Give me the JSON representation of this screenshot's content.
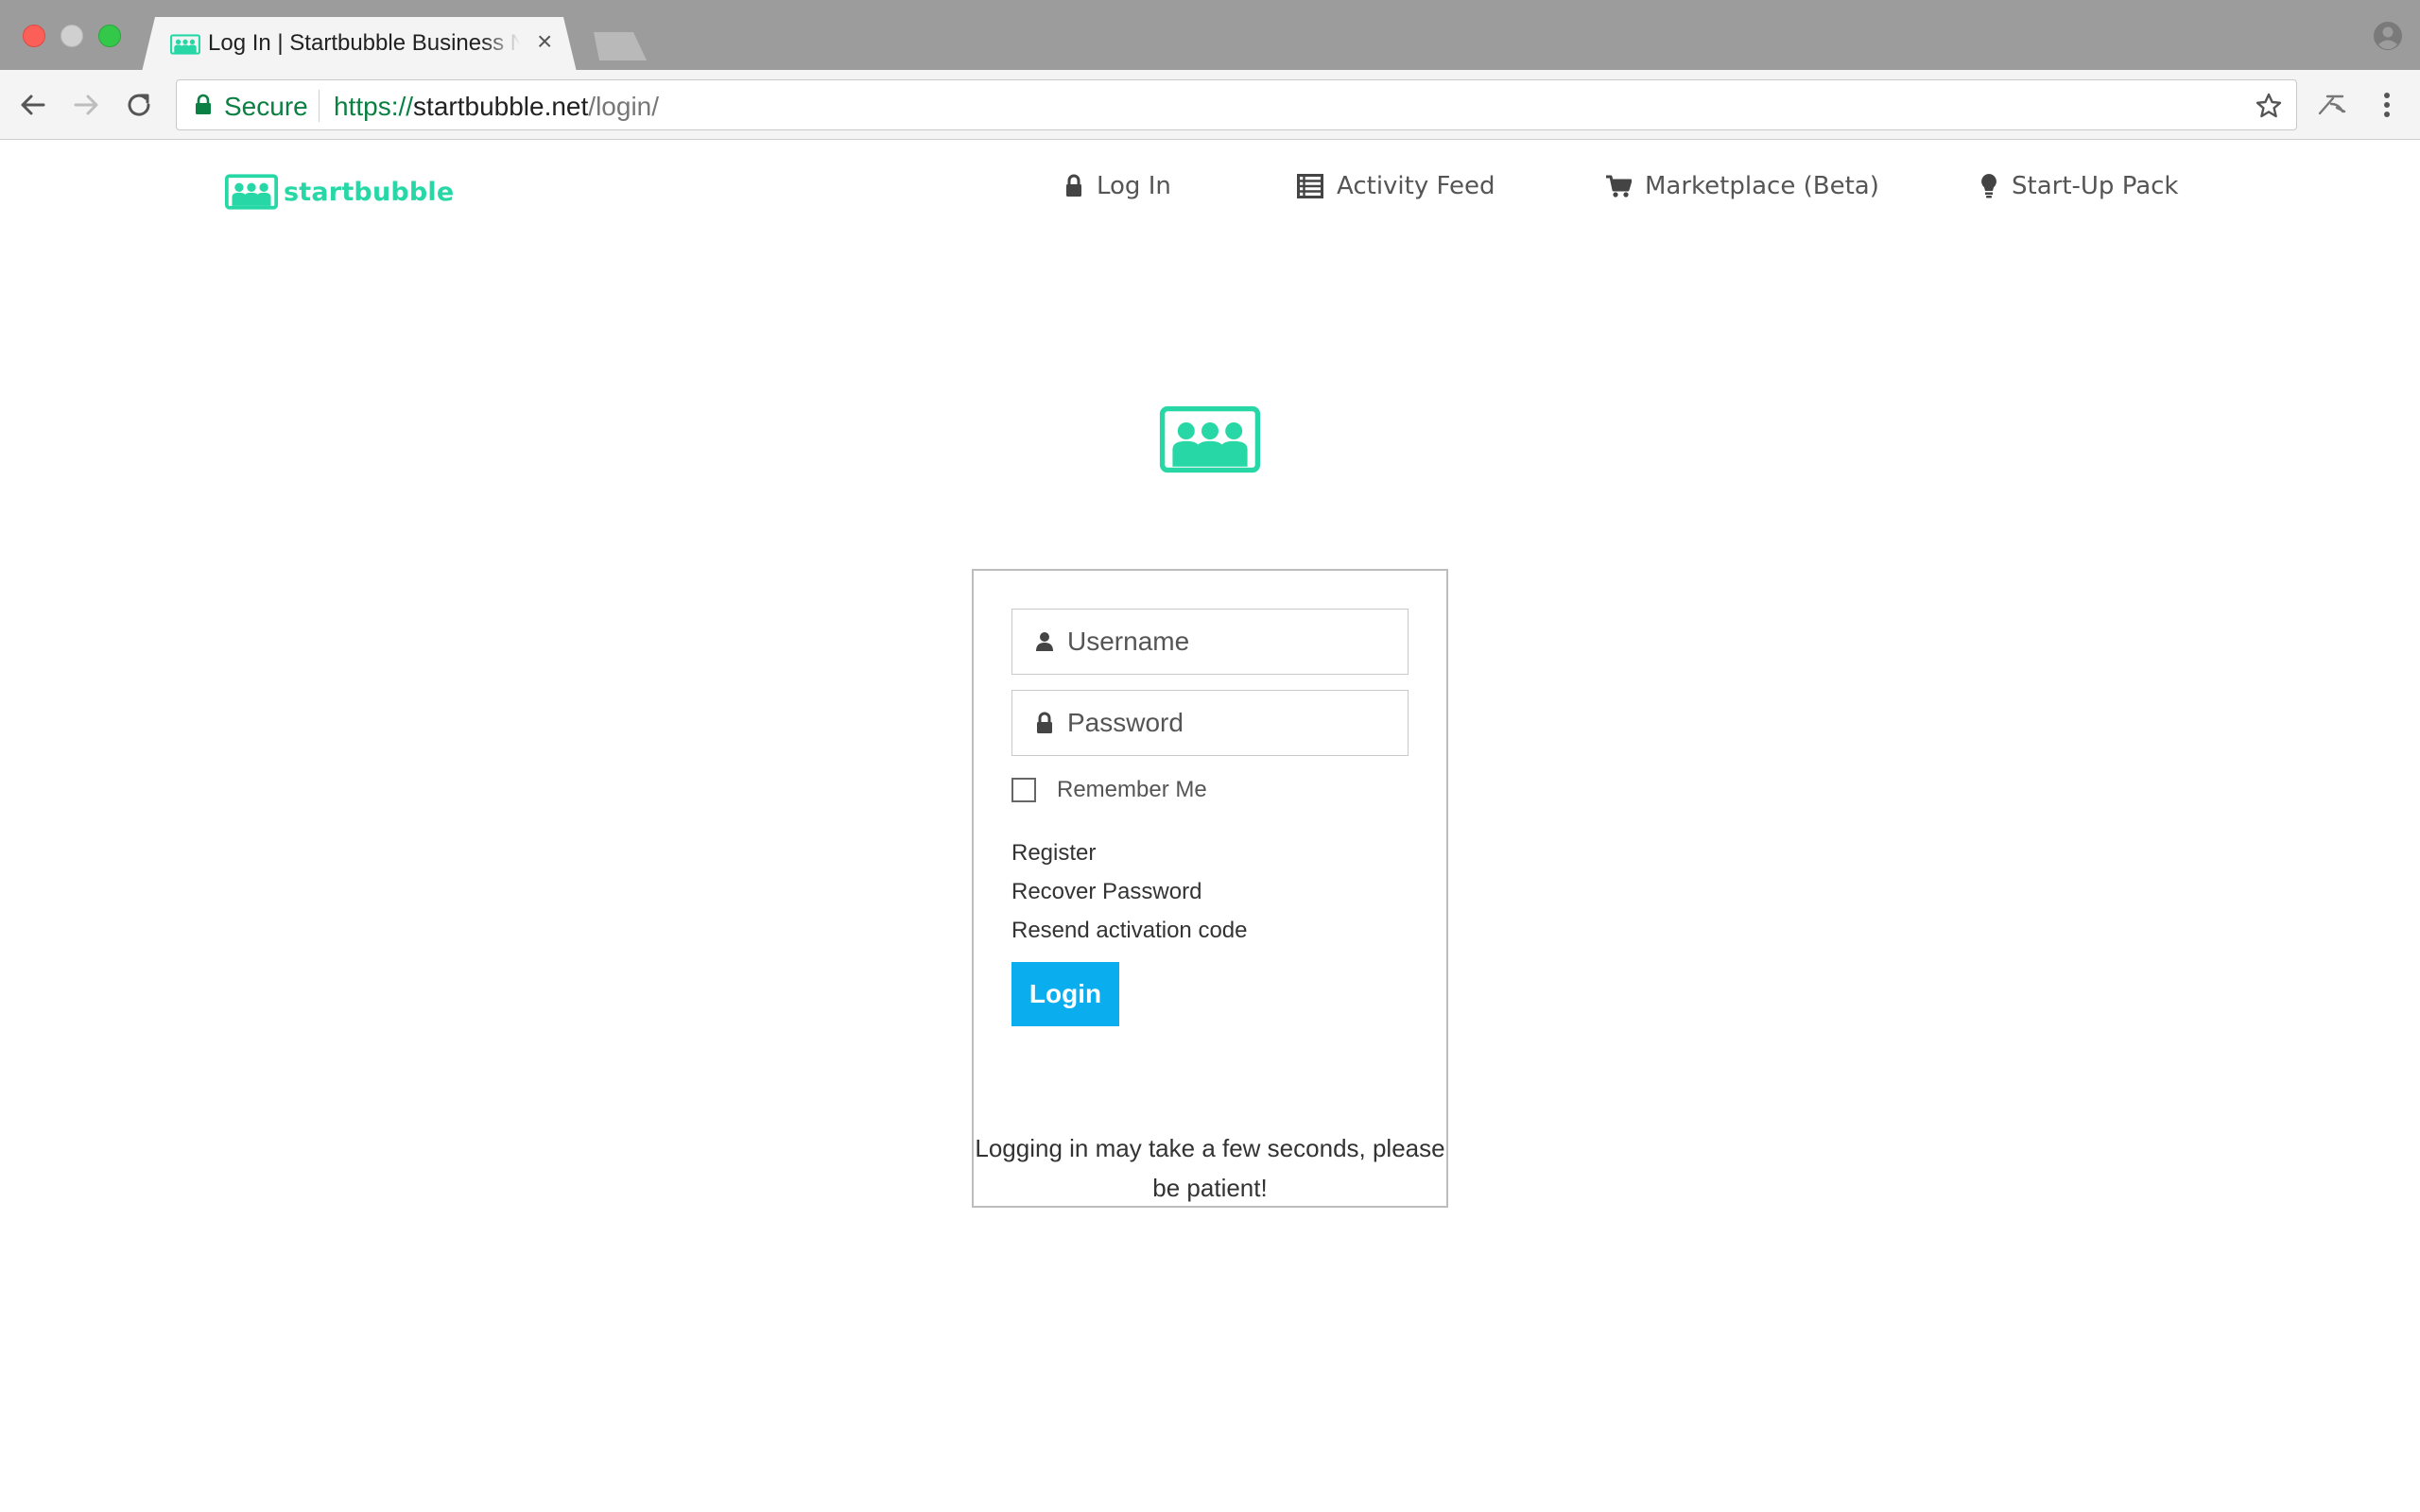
{
  "browser": {
    "tab_title": "Log In | Startbubble Business Network",
    "tab_close": "×",
    "secure_label": "Secure",
    "url_scheme": "https://",
    "url_host": "startbubble.net",
    "url_path": "/login/"
  },
  "brand": {
    "name": "startbubble",
    "color": "#27d8a6"
  },
  "nav": {
    "login": "Log In",
    "activity_feed": "Activity Feed",
    "marketplace": "Marketplace (Beta)",
    "startup_pack": "Start-Up Pack"
  },
  "login_form": {
    "username_placeholder": "Username",
    "password_placeholder": "Password",
    "remember_me": "Remember Me",
    "links": [
      "Register",
      "Recover Password",
      "Resend activation code"
    ],
    "submit_label": "Login",
    "submit_color": "#0aadee"
  },
  "notice": {
    "line1": "Logging in may take a few seconds, please",
    "line2": "be patient!"
  }
}
